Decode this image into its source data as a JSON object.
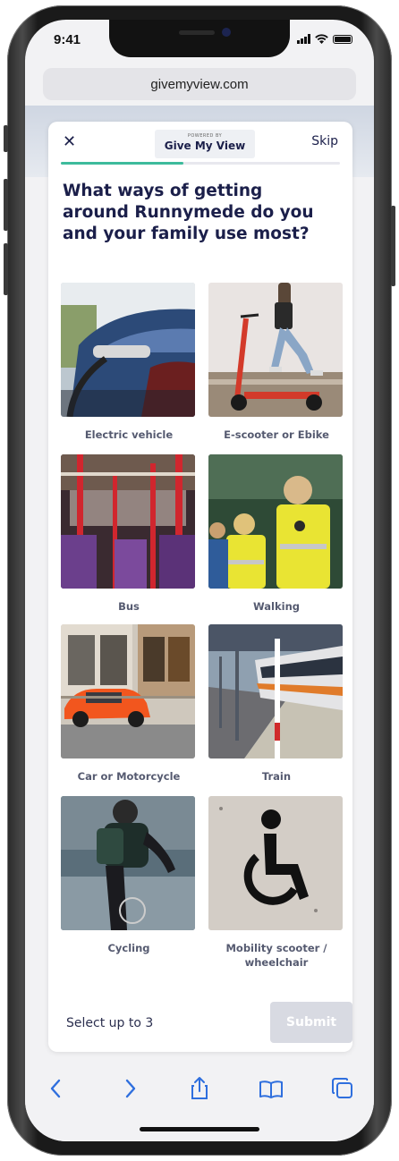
{
  "status": {
    "time": "9:41"
  },
  "browser": {
    "url": "givemyview.com"
  },
  "header": {
    "close_glyph": "✕",
    "powered_by": "POWERED BY",
    "brand": "Give My View",
    "skip_label": "Skip",
    "progress": 0.44
  },
  "question": "What ways of getting around Runnymede do you and your family use most?",
  "options": [
    {
      "label": "Electric vehicle"
    },
    {
      "label": "E-scooter or Ebike"
    },
    {
      "label": "Bus"
    },
    {
      "label": "Walking"
    },
    {
      "label": "Car or Motorcycle"
    },
    {
      "label": "Train"
    },
    {
      "label": "Cycling"
    },
    {
      "label": "Mobility scooter / wheelchair"
    }
  ],
  "footer": {
    "select_hint": "Select up to 3",
    "submit_label": "Submit"
  },
  "toolbar": {
    "back_icon": "chevron-left-icon",
    "forward_icon": "chevron-right-icon",
    "share_icon": "share-icon",
    "bookmarks_icon": "book-icon",
    "tabs_icon": "tabs-icon"
  },
  "colors": {
    "brand_navy": "#1b1f4a",
    "progress_green": "#3dbb9c",
    "ios_blue": "#2f6fde",
    "submit_disabled": "#d8dae2"
  }
}
